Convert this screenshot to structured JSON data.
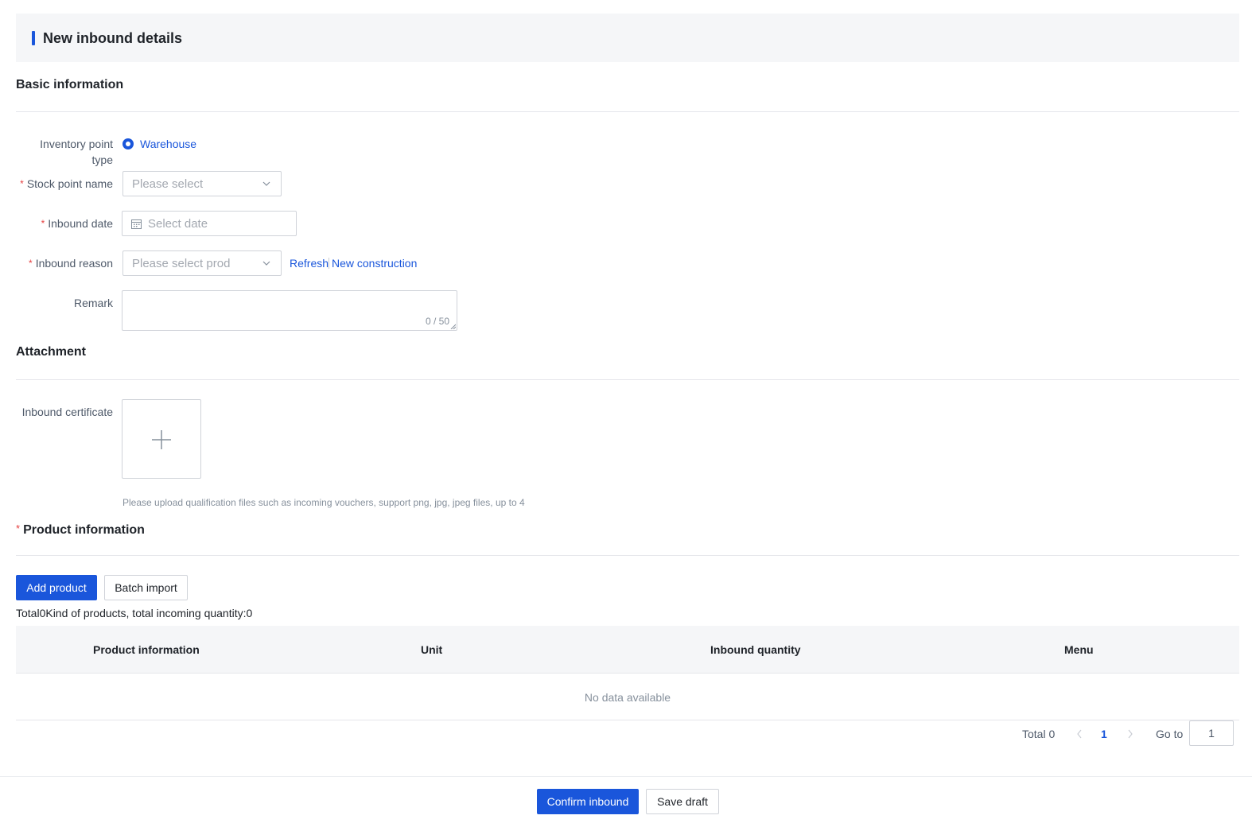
{
  "page": {
    "title": "New inbound details"
  },
  "sections": {
    "basic": "Basic information",
    "attachment": "Attachment",
    "product": "Product information"
  },
  "form": {
    "inventory_type": {
      "label": "Inventory point type",
      "option": "Warehouse",
      "selected": true
    },
    "stock_point": {
      "label": "Stock point name",
      "placeholder": "Please select"
    },
    "inbound_date": {
      "label": "Inbound date",
      "placeholder": "Select date"
    },
    "inbound_reason": {
      "label": "Inbound reason",
      "placeholder": "Please select prod",
      "refresh": "Refresh",
      "new_construction": "New construction"
    },
    "remark": {
      "label": "Remark",
      "count": "0 / 50"
    }
  },
  "attachment": {
    "label": "Inbound certificate",
    "hint": "Please upload qualification files such as incoming vouchers, support png, jpg, jpeg files, up to 4"
  },
  "products": {
    "add_button": "Add product",
    "import_button": "Batch import",
    "summary": "Total0Kind of products, total incoming quantity:0",
    "columns": [
      "Product information",
      "Unit",
      "Inbound quantity",
      "Menu"
    ],
    "empty": "No data available"
  },
  "pagination": {
    "total": "Total 0",
    "current": "1",
    "goto_label": "Go to",
    "goto_value": "1"
  },
  "footer": {
    "confirm": "Confirm inbound",
    "draft": "Save draft"
  },
  "colors": {
    "accent": "#1a56db",
    "required": "#e53e3e",
    "header_bg": "#f5f6f8"
  }
}
